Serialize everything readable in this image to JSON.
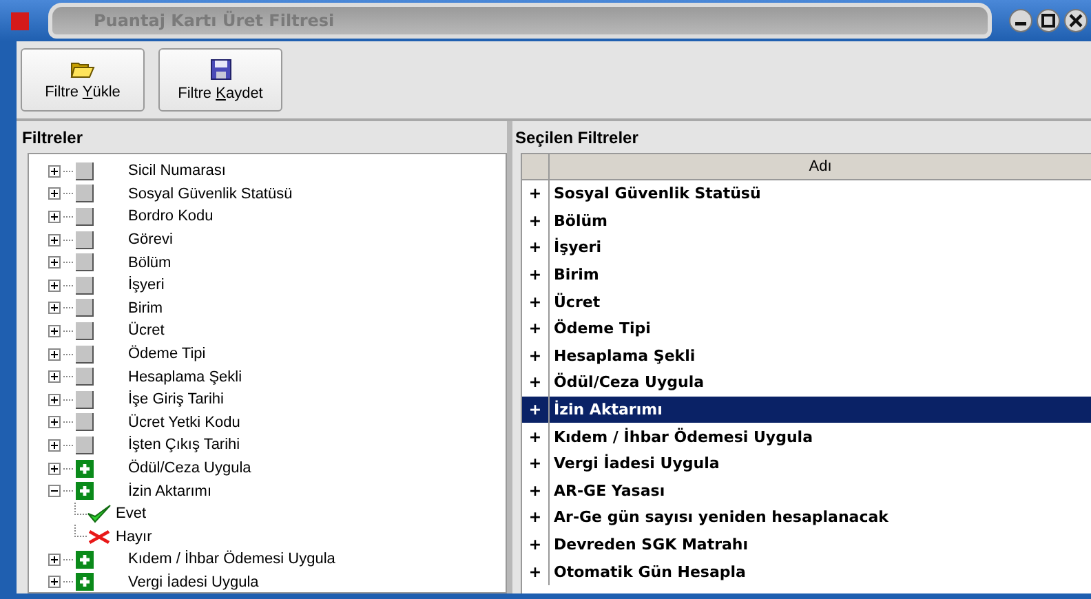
{
  "window": {
    "title": "Puantaj Kartı Üret Filtresi"
  },
  "toolbar": [
    {
      "label_start": "Filtre ",
      "access_key": "Y",
      "label_end": "ükle",
      "kind": "open"
    },
    {
      "label_start": "Filtre ",
      "access_key": "K",
      "label_end": "aydet",
      "kind": "save"
    }
  ],
  "filters": {
    "title": "Filtreler",
    "items": [
      {
        "label": "Sicil Numarası",
        "expanded": false,
        "active": false
      },
      {
        "label": "Sosyal Güvenlik Statüsü",
        "expanded": false,
        "active": false
      },
      {
        "label": "Bordro Kodu",
        "expanded": false,
        "active": false
      },
      {
        "label": "Görevi",
        "expanded": false,
        "active": false
      },
      {
        "label": "Bölüm",
        "expanded": false,
        "active": false
      },
      {
        "label": "İşyeri",
        "expanded": false,
        "active": false
      },
      {
        "label": "Birim",
        "expanded": false,
        "active": false
      },
      {
        "label": "Ücret",
        "expanded": false,
        "active": false
      },
      {
        "label": "Ödeme Tipi",
        "expanded": false,
        "active": false
      },
      {
        "label": "Hesaplama Şekli",
        "expanded": false,
        "active": false
      },
      {
        "label": "İşe Giriş Tarihi",
        "expanded": false,
        "active": false
      },
      {
        "label": "Ücret Yetki Kodu",
        "expanded": false,
        "active": false
      },
      {
        "label": "İşten Çıkış Tarihi",
        "expanded": false,
        "active": false
      },
      {
        "label": "Ödül/Ceza Uygula",
        "expanded": false,
        "active": true
      },
      {
        "label": "İzin Aktarımı",
        "expanded": true,
        "active": true,
        "children": [
          {
            "label": "Evet",
            "kind": "check"
          },
          {
            "label": "Hayır",
            "kind": "cross"
          }
        ]
      },
      {
        "label": "Kıdem / İhbar Ödemesi Uygula",
        "expanded": false,
        "active": true
      },
      {
        "label": "Vergi İadesi Uygula",
        "expanded": false,
        "active": true
      }
    ]
  },
  "selected_filters": {
    "title": "Seçilen Filtreler",
    "column": "Adı",
    "rows": [
      {
        "mark": "+",
        "label": "Sosyal Güvenlik Statüsü",
        "selected": false
      },
      {
        "mark": "+",
        "label": "Bölüm",
        "selected": false
      },
      {
        "mark": "+",
        "label": "İşyeri",
        "selected": false
      },
      {
        "mark": "+",
        "label": "Birim",
        "selected": false
      },
      {
        "mark": "+",
        "label": "Ücret",
        "selected": false
      },
      {
        "mark": "+",
        "label": "Ödeme Tipi",
        "selected": false
      },
      {
        "mark": "+",
        "label": "Hesaplama Şekli",
        "selected": false
      },
      {
        "mark": "+",
        "label": "Ödül/Ceza Uygula",
        "selected": false
      },
      {
        "mark": "+",
        "label": "İzin Aktarımı",
        "selected": true
      },
      {
        "mark": "+",
        "label": "Kıdem / İhbar Ödemesi Uygula",
        "selected": false
      },
      {
        "mark": "+",
        "label": "Vergi İadesi Uygula",
        "selected": false
      },
      {
        "mark": "+",
        "label": "AR-GE Yasası",
        "selected": false
      },
      {
        "mark": "+",
        "label": "Ar-Ge gün sayısı yeniden hesaplanacak",
        "selected": false
      },
      {
        "mark": "+",
        "label": "Devreden SGK Matrahı",
        "selected": false
      },
      {
        "mark": "+",
        "label": "Otomatik Gün Hesapla",
        "selected": false
      }
    ]
  }
}
